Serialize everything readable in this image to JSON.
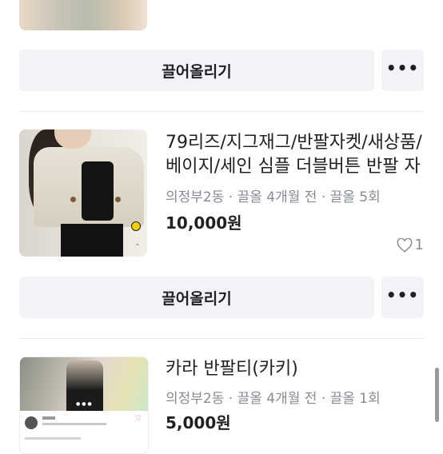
{
  "buttons": {
    "pull_up_label": "끌어올리기",
    "more_label": "•••"
  },
  "listings": [
    {
      "title": "",
      "meta": "",
      "price": ""
    },
    {
      "title": "79리즈/지그재그/반팔자켓/새상품/베이지/세인 심플 더블버튼 반팔 자",
      "meta": "의정부2동 · 끌올 4개월 전 · 끌올 5회",
      "price": "10,000원",
      "likes": "1"
    },
    {
      "title": "카라 반팔티(카키)",
      "meta": "의정부2동 · 끌올 4개월 전 · 끌올 1회",
      "price": "5,000원"
    }
  ]
}
